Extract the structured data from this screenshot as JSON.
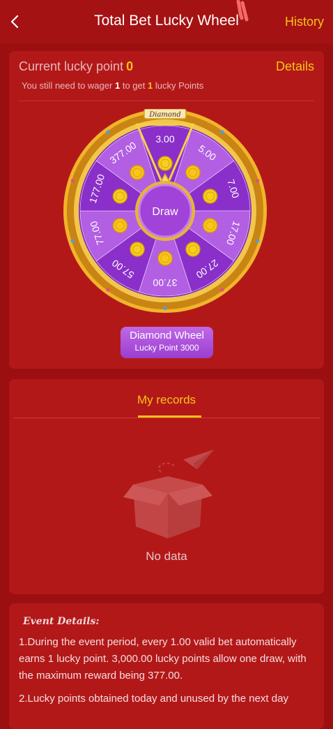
{
  "header": {
    "title": "Total Bet Lucky Wheel",
    "history_label": "History",
    "back_icon": "chevron-left-icon"
  },
  "lucky": {
    "label": "Current lucky point",
    "value": "0",
    "details_label": "Details",
    "need_prefix": "You still need to wager",
    "need_amount": "1",
    "need_mid": "to get",
    "need_points": "1",
    "need_suffix": "lucky Points"
  },
  "wheel": {
    "banner": "Diamond",
    "center_label": "Draw",
    "segments": [
      "3.00",
      "5.00",
      "7.00",
      "17.00",
      "27.00",
      "37.00",
      "57.00",
      "77.00",
      "177.00",
      "377.00"
    ],
    "button_title": "Diamond Wheel",
    "button_sub": "Lucky Point 3000",
    "colors": {
      "dark": "#8a2fc9",
      "light": "#b25fe3",
      "rim": "#e9a722"
    }
  },
  "records": {
    "tab_label": "My records",
    "empty_label": "No data"
  },
  "event": {
    "title": "Event Details:",
    "p1": "1.During the event period, every 1.00 valid bet automatically earns 1 lucky point. 3,000.00 lucky points allow one draw, with the maximum reward being 377.00.",
    "p2": "2.Lucky points obtained today and unused by the next day"
  }
}
